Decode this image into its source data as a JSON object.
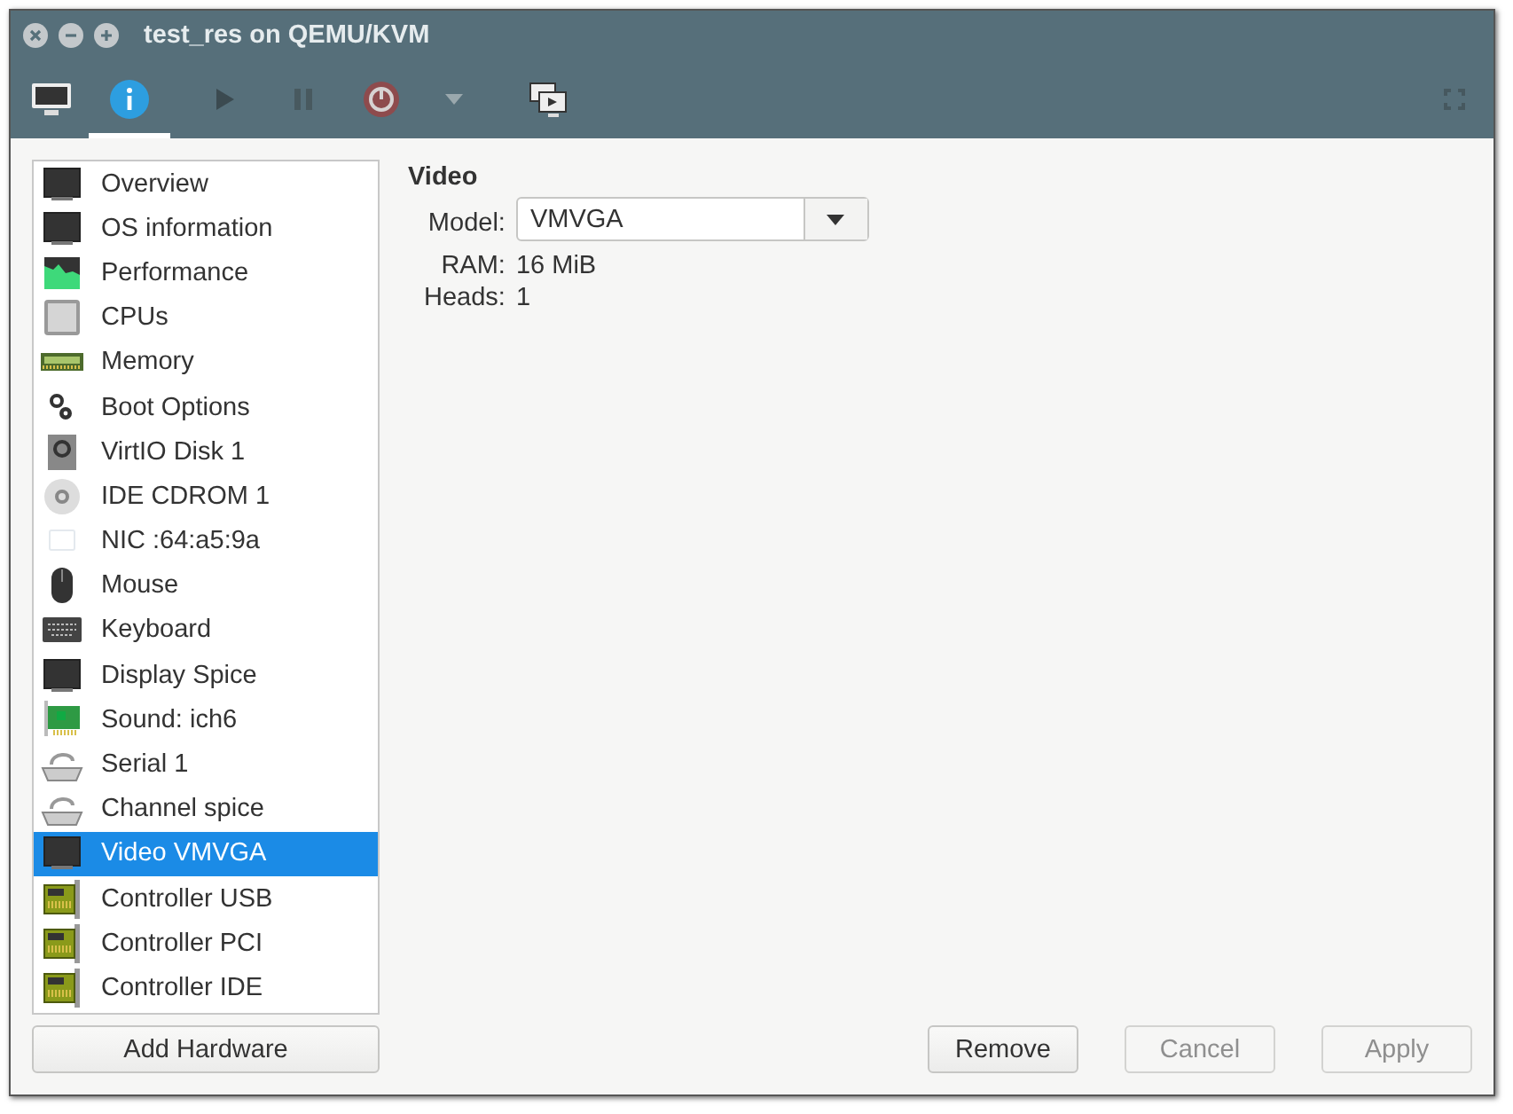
{
  "window": {
    "title": "test_res on QEMU/KVM"
  },
  "toolbar": [
    {
      "kind": "console",
      "selected": false
    },
    {
      "kind": "details",
      "selected": true
    },
    {
      "kind": "run",
      "selected": false
    },
    {
      "kind": "pause",
      "selected": false
    },
    {
      "kind": "shutdown",
      "selected": false
    },
    {
      "kind": "caret",
      "selected": false
    },
    {
      "kind": "snapshots",
      "selected": false
    },
    {
      "kind": "fullscreen",
      "selected": false
    }
  ],
  "sidebar": {
    "items": [
      {
        "label": "Overview",
        "kind": "monitor",
        "selected": false
      },
      {
        "label": "OS information",
        "kind": "monitor",
        "selected": false
      },
      {
        "label": "Performance",
        "kind": "chart",
        "selected": false
      },
      {
        "label": "CPUs",
        "kind": "cpu",
        "selected": false
      },
      {
        "label": "Memory",
        "kind": "memory",
        "selected": false
      },
      {
        "label": "Boot Options",
        "kind": "gears",
        "selected": false
      },
      {
        "label": "VirtIO Disk 1",
        "kind": "disk",
        "selected": false
      },
      {
        "label": "IDE CDROM 1",
        "kind": "cdrom",
        "selected": false
      },
      {
        "label": "NIC :64:a5:9a",
        "kind": "nic",
        "selected": false
      },
      {
        "label": "Mouse",
        "kind": "mouse",
        "selected": false
      },
      {
        "label": "Keyboard",
        "kind": "keyboard",
        "selected": false
      },
      {
        "label": "Display Spice",
        "kind": "monitor",
        "selected": false
      },
      {
        "label": "Sound: ich6",
        "kind": "sound",
        "selected": false
      },
      {
        "label": "Serial 1",
        "kind": "serial",
        "selected": false
      },
      {
        "label": "Channel spice",
        "kind": "serial",
        "selected": false
      },
      {
        "label": "Video VMVGA",
        "kind": "monitor",
        "selected": true
      },
      {
        "label": "Controller USB",
        "kind": "controller",
        "selected": false
      },
      {
        "label": "Controller PCI",
        "kind": "controller",
        "selected": false
      },
      {
        "label": "Controller IDE",
        "kind": "controller",
        "selected": false
      }
    ],
    "add_button": "Add Hardware"
  },
  "details": {
    "heading": "Video",
    "model": {
      "label": "Model:",
      "value": "VMVGA"
    },
    "fields": [
      {
        "label": "RAM:",
        "value": "16 MiB"
      },
      {
        "label": "Heads:",
        "value": "1"
      }
    ]
  },
  "buttons": [
    {
      "label": "Remove",
      "disabled": false
    },
    {
      "label": "Cancel",
      "disabled": true
    },
    {
      "label": "Apply",
      "disabled": true
    }
  ]
}
